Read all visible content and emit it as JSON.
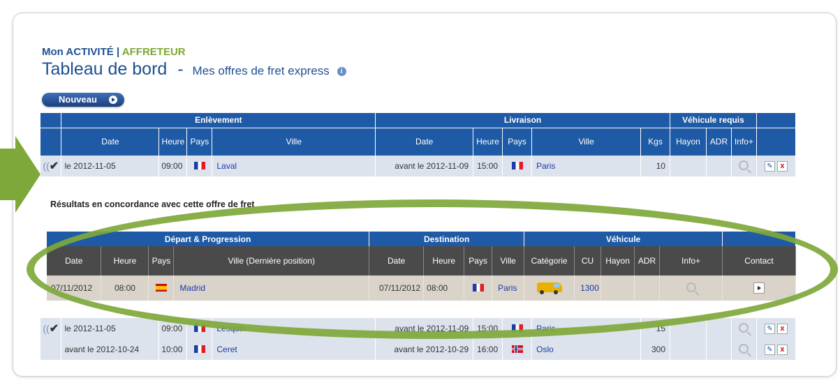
{
  "section": {
    "title": "Mon ACTIVITÉ",
    "separator": "|",
    "sub": "AFFRETEUR"
  },
  "heading": {
    "title": "Tableau de bord",
    "dash": "-",
    "subtitle": "Mes offres de fret express",
    "info_icon": "info-icon"
  },
  "new_button": {
    "label": "Nouveau"
  },
  "offers_table": {
    "groups": [
      "Enlèvement",
      "Livraison",
      "Véhicule requis"
    ],
    "columns": [
      "Date",
      "Heure",
      "Pays",
      "Ville",
      "Date",
      "Heure",
      "Pays",
      "Ville",
      "Kgs",
      "Hayon",
      "ADR",
      "Info+"
    ],
    "rows": [
      {
        "pick_date": "le 2012-11-05",
        "pick_time": "09:00",
        "pick_country": "fr",
        "pick_city": "Laval",
        "del_date": "avant le 2012-11-09",
        "del_time": "15:00",
        "del_country": "fr",
        "del_city": "Paris",
        "kgs": "10",
        "checked": true
      },
      {
        "pick_date": "le 2012-11-05",
        "pick_time": "09:00",
        "pick_country": "fr",
        "pick_city": "Lesquin",
        "del_date": "avant le 2012-11-09",
        "del_time": "15:00",
        "del_country": "fr",
        "del_city": "Paris",
        "kgs": "15",
        "checked": true
      },
      {
        "pick_date": "avant le 2012-10-24",
        "pick_time": "10:00",
        "pick_country": "fr",
        "pick_city": "Ceret",
        "del_date": "avant le 2012-10-29",
        "del_time": "16:00",
        "del_country": "no",
        "del_city": "Oslo",
        "kgs": "300",
        "checked": false
      }
    ]
  },
  "results_label": "Résultats en concordance avec cette offre de fret",
  "match_table": {
    "groups": [
      "Départ & Progression",
      "Destination",
      "Véhicule"
    ],
    "columns": [
      "Date",
      "Heure",
      "Pays",
      "Ville (Dernière position)",
      "Date",
      "Heure",
      "Pays",
      "Ville",
      "Catégorie",
      "CU",
      "Hayon",
      "ADR",
      "Info+",
      "Contact"
    ],
    "row": {
      "dep_date": "07/11/2012",
      "dep_time": "08:00",
      "dep_country": "es",
      "dep_city": "Madrid",
      "dest_date": "07/11/2012",
      "dest_time": "08:00",
      "dest_country": "fr",
      "dest_city": "Paris",
      "category_icon": "van-icon",
      "cu": "1300"
    }
  },
  "colors": {
    "header_blue": "#1e5aa5",
    "highlight_green": "#7ea83a",
    "dark_header": "#4a4a4a"
  }
}
